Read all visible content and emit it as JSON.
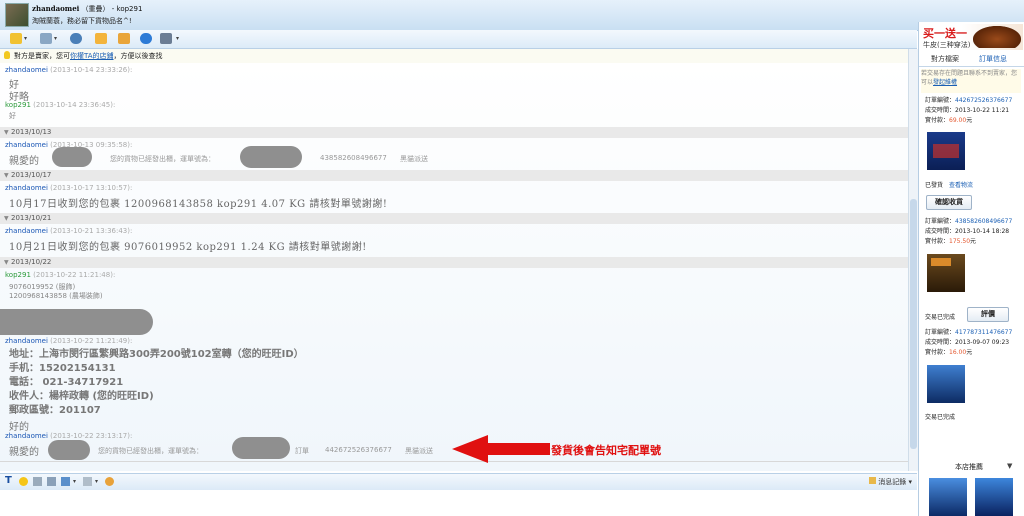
{
  "window": {
    "contact_name": "zhandaomei",
    "contact_status": "（重疊）",
    "separator": " - ",
    "own_id": "kop291",
    "contact_signature": "淘賊蘭蓑，務必留下貨物品名^!"
  },
  "toolbar": {
    "icons": [
      "folder-icon",
      "robot-icon",
      "webcam-icon",
      "folder-icon",
      "file-icon",
      "globe-icon",
      "contact-icon"
    ]
  },
  "notice": {
    "prefix": "對方是賣家，您可",
    "link": "你權TA的店鋪",
    "suffix": "，方便以後查找"
  },
  "messages": {
    "m1_name": "zhandaomei",
    "m1_time": "(2013-10-14 23:33:26):",
    "m1_line1": "好",
    "m1_line2": "好略",
    "m2_name": "kop291",
    "m2_time": "(2013-10-14 23:36:45):",
    "m2_line1": "好",
    "d1": "2013/10/13",
    "m3_name": "zhandaomei",
    "m3_time": "(2013-10-13 09:35:58):",
    "m3_greeting": "親愛的",
    "m3_text": "您的貨物已經發出櫃，運單號為：",
    "m3_tracking": "438582608496677",
    "m3_courier": "黑貓派送",
    "d2": "2013/10/17",
    "m4_name": "zhandaomei",
    "m4_time": "(2013-10-17 13:10:57):",
    "m4_text": "10月17日收到您的包裹  1200968143858    kop291    4.07    KG    請核對單號謝謝!",
    "d3": "2013/10/21",
    "m5_name": "zhandaomei",
    "m5_time": "(2013-10-21 13:36:43):",
    "m5_text": "10月21日收到您的包裹  9076019952    kop291    1.24    KG    請核對單號謝謝!",
    "d4": "2013/10/22",
    "m6_name": "kop291",
    "m6_time": "(2013-10-22 11:21:48):",
    "m6_line1": "9076019952  (服飾)",
    "m6_line2": "1200968143858  (農場裝飾)",
    "m7_name": "zhandaomei",
    "m7_time": "(2013-10-22 11:21:49):",
    "m7_addr1": "地址：上海市閔行區繁興路300弄200號102室轉（您的旺旺ID）",
    "m7_addr2": "手机：15202154131",
    "m7_addr3": "電話： 021-34717921",
    "m7_addr4": "收件人：楊梓政轉    (您的旺旺ID)",
    "m7_addr5": "郵政區號：201107",
    "m7_addr6": "好的",
    "m8_name": "zhandaomei",
    "m8_time": "(2013-10-22 23:13:17):",
    "m8_greeting": "親愛的",
    "m8_text": "您的貨物已經發出櫃，運單號為：",
    "m8_label": "訂單",
    "m8_tracking": "442672526376677",
    "m8_courier": "黑貓派送"
  },
  "annotation": {
    "text": "發貨後會告知宅配單號",
    "color": "#e01010"
  },
  "input_toolbar": {
    "history_label": "消息記錄"
  },
  "sidebar": {
    "ad_title": "买一送一",
    "ad_sub": "牛皮(三种穿法)",
    "tab_files": "對方檔案",
    "tab_orders": "訂單信息",
    "tip_text": "若交易存在問題且聯系不到賣家，您可以",
    "tip_link": "發起維權",
    "orders": [
      {
        "no_label": "訂單編號：",
        "no": "442672526376677",
        "time_label": "成交時間：",
        "time": "2013-10-22 11:21",
        "paid_label": "實付款：",
        "paid": "69.00",
        "unit": "元",
        "status": "已發貨",
        "link": "查看物流",
        "button": "確認收貨"
      },
      {
        "no_label": "訂單編號：",
        "no": "438582608496677",
        "time_label": "成交時間：",
        "time": "2013-10-14 18:28",
        "paid_label": "實付款：",
        "paid": "175.50",
        "unit": "元",
        "status": "交易已完成",
        "button": "評價"
      },
      {
        "no_label": "訂單編號：",
        "no": "417787311476677",
        "time_label": "成交時間：",
        "time": "2013-09-07 09:23",
        "paid_label": "實付款：",
        "paid": "16.00",
        "unit": "元",
        "status": "交易已完成"
      }
    ],
    "recommend_title": "本店推薦"
  }
}
